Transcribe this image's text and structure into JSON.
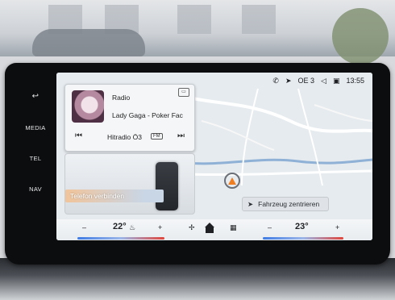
{
  "side_buttons": [
    {
      "label": "↩",
      "icon": "back-icon"
    },
    {
      "label": "MEDIA"
    },
    {
      "label": "TEL"
    },
    {
      "label": "NAV"
    }
  ],
  "status": {
    "signal_icon": "phone-signal-icon",
    "location_icon": "location-icon",
    "station_short": "OE 3",
    "volume_icon": "speaker-icon",
    "bluetooth_icon": "bluetooth-icon",
    "time": "13:55"
  },
  "media": {
    "source": "Radio",
    "track": "Lady Gaga - Poker Fac",
    "station": "Hitradio Ö3",
    "band": "FM"
  },
  "phone": {
    "connect_label": "Telefon verbinden"
  },
  "map": {
    "center_label": "Fahrzeug zentrieren"
  },
  "climate": {
    "left_minus": "–",
    "left_temp": "22°",
    "left_plus": "+",
    "right_minus": "–",
    "right_temp": "23°",
    "right_plus": "+"
  },
  "colors": {
    "accent_blue": "#3e7be3",
    "accent_red": "#e0453a",
    "nav_arrow": "#ef7e22"
  }
}
